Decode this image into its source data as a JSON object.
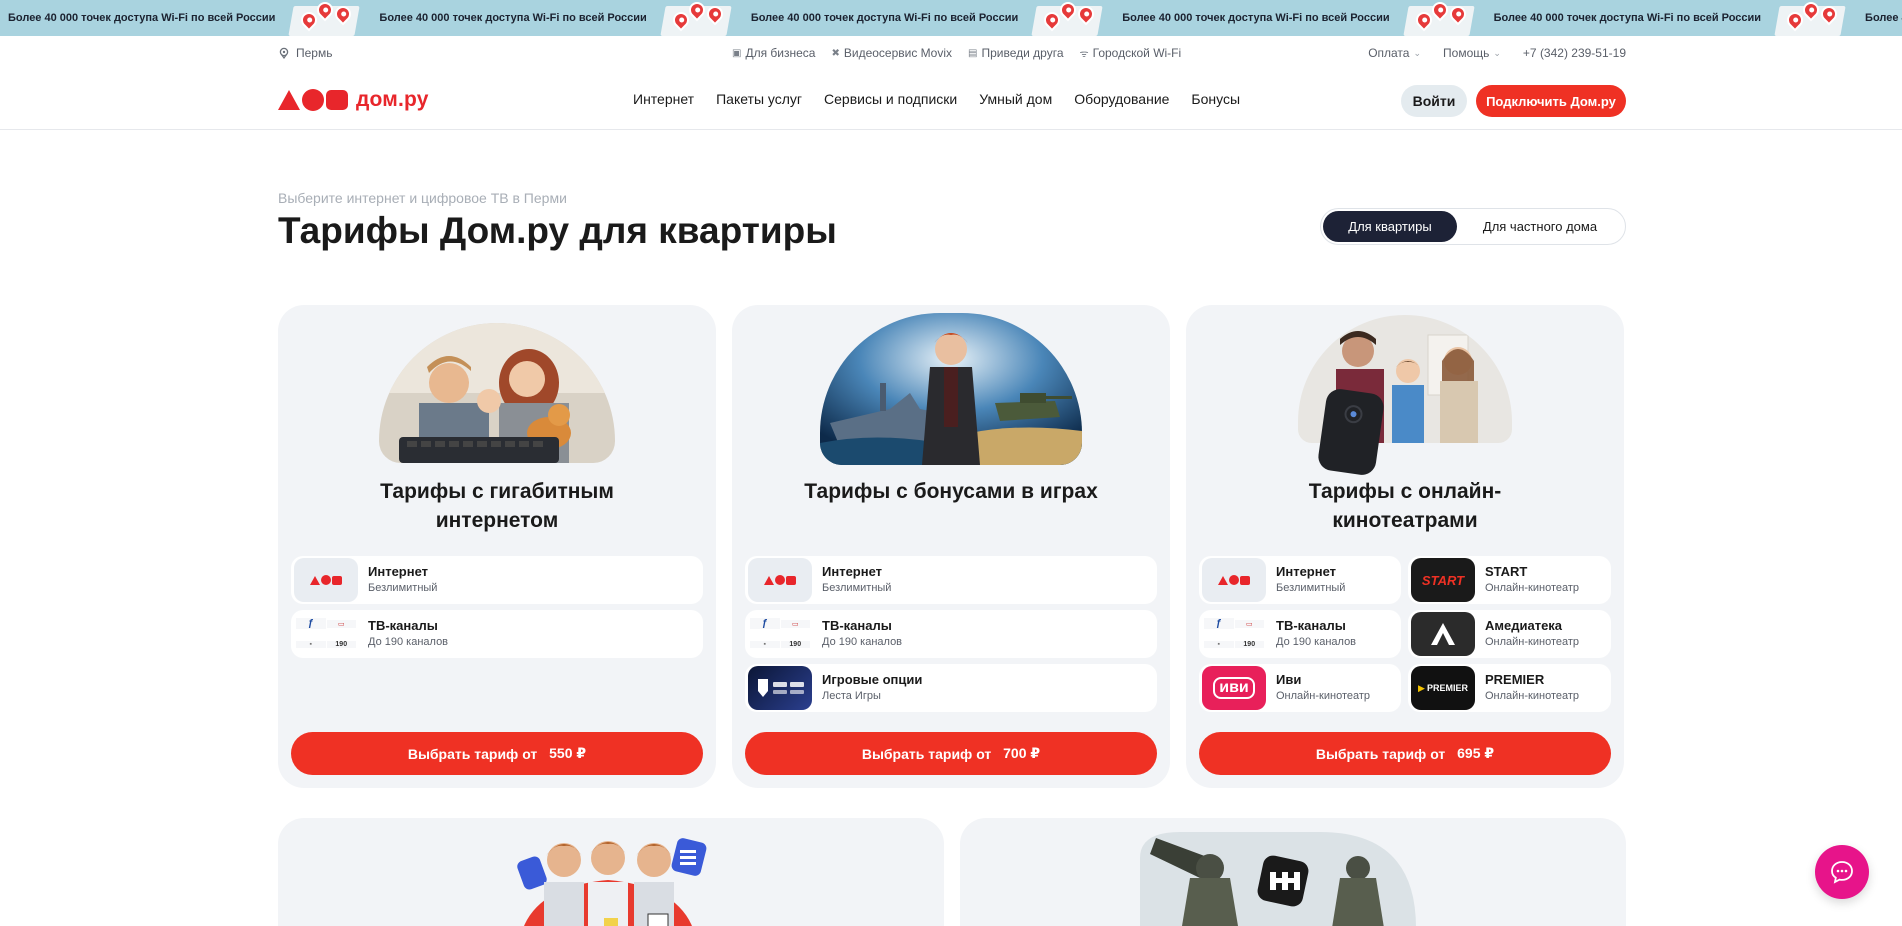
{
  "promo": {
    "text": "Более 40 000 точек доступа Wi-Fi по всей России"
  },
  "utility": {
    "city": "Пермь",
    "links": [
      "Для бизнеса",
      "Видеосервис Movix",
      "Приведи друга",
      "Городской Wi-Fi"
    ],
    "payment": "Оплата",
    "help": "Помощь",
    "phone": "+7 (342) 239-51-19"
  },
  "header": {
    "logo_text": "дом.ру",
    "nav": [
      "Интернет",
      "Пакеты услуг",
      "Сервисы и подписки",
      "Умный дом",
      "Оборудование",
      "Бонусы"
    ],
    "login": "Войти",
    "connect": "Подключить Дом.ру"
  },
  "hero": {
    "subtitle": "Выберите интернет и цифровое ТВ в Перми",
    "title": "Тарифы Дом.ру для квартиры",
    "toggle": [
      "Для квартиры",
      "Для частного дома"
    ]
  },
  "cards": [
    {
      "title": "Тарифы с гигабитным интернетом",
      "options": [
        {
          "name": "Интернет",
          "sub": "Безлимитный"
        },
        {
          "name": "ТВ-каналы",
          "sub": "До 190 каналов"
        }
      ],
      "cta": "Выбрать тариф от",
      "price": "550 ₽"
    },
    {
      "title": "Тарифы с бонусами в играх",
      "options": [
        {
          "name": "Интернет",
          "sub": "Безлимитный"
        },
        {
          "name": "ТВ-каналы",
          "sub": "До 190 каналов"
        },
        {
          "name": "Игровые опции",
          "sub": "Леста Игры"
        }
      ],
      "cta": "Выбрать тариф от",
      "price": "700 ₽"
    },
    {
      "title": "Тарифы с онлайн-кинотеатрами",
      "options": [
        {
          "name": "Интернет",
          "sub": "Безлимитный"
        },
        {
          "name": "START",
          "sub": "Онлайн-кинотеатр"
        },
        {
          "name": "ТВ-каналы",
          "sub": "До 190 каналов"
        },
        {
          "name": "Амедиатека",
          "sub": "Онлайн-кинотеатр"
        },
        {
          "name": "Иви",
          "sub": "Онлайн-кинотеатр"
        },
        {
          "name": "PREMIER",
          "sub": "Онлайн-кинотеатр"
        }
      ],
      "cta": "Выбрать тариф от",
      "price": "695 ₽"
    }
  ],
  "tv_tile": {
    "count": "190"
  },
  "logos": {
    "start": "START",
    "ivi": "иви",
    "premier": "PREMIER"
  },
  "colors": {
    "brand_red": "#ef3124",
    "dark": "#1d2236",
    "chat": "#e7148a",
    "promo_bg": "#a9d3df"
  }
}
